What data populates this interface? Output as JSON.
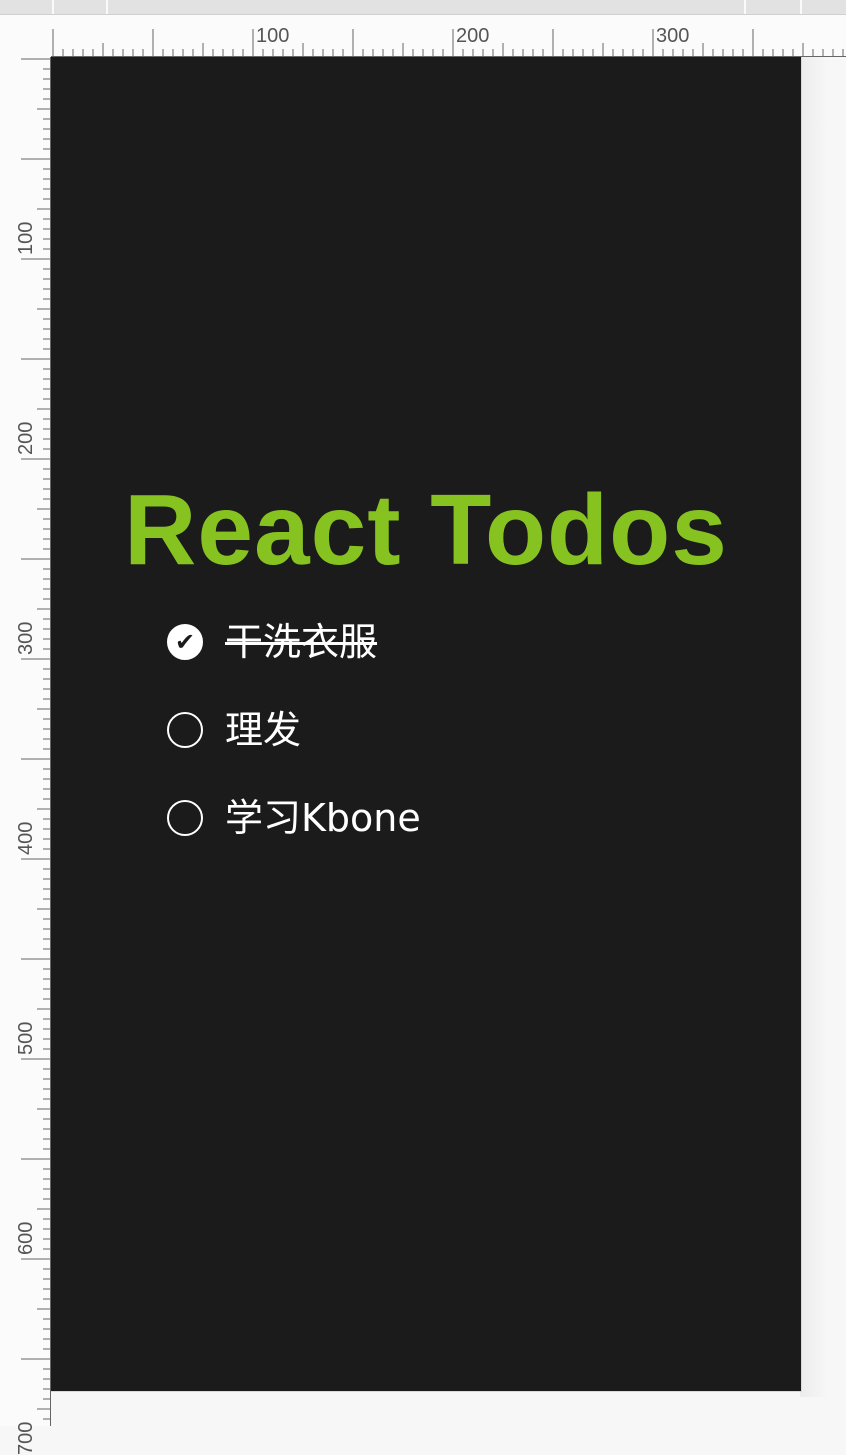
{
  "app": {
    "title": "React Todos",
    "title_color": "#87c320",
    "background": "#1b1b1b",
    "todos": [
      {
        "text": "干洗衣服",
        "completed": true
      },
      {
        "text": "理发",
        "completed": false
      },
      {
        "text": "学习Kbone",
        "completed": false
      }
    ]
  },
  "rulers": {
    "horizontal_labels": [
      "100",
      "200",
      "300"
    ],
    "vertical_labels": [
      "100",
      "200",
      "300",
      "400",
      "500",
      "600",
      "700"
    ]
  },
  "icons": {
    "checked": "check-circle-filled-icon",
    "unchecked": "circle-outline-icon"
  }
}
